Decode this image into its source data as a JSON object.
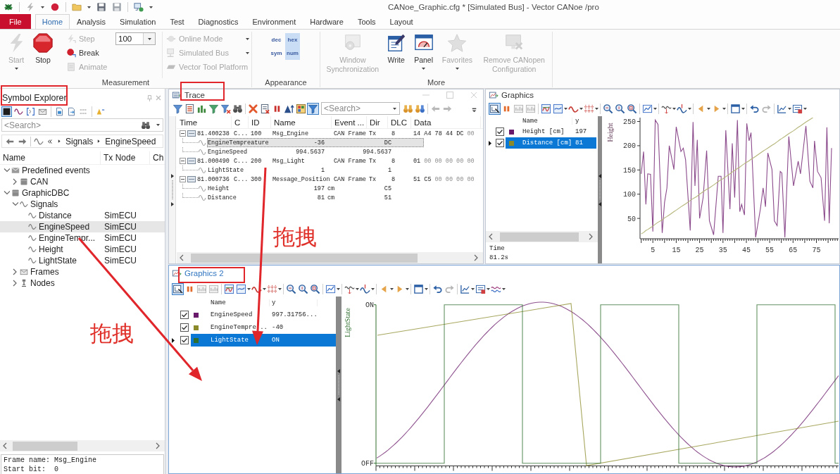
{
  "window": {
    "title": "CANoe_Graphic.cfg * [Simulated Bus] - Vector CANoe /pro"
  },
  "ribbon": {
    "tabs": [
      {
        "label": "File",
        "kind": "file",
        "selected": false
      },
      {
        "label": "Home",
        "kind": "tab",
        "selected": true
      },
      {
        "label": "Analysis",
        "kind": "tab",
        "selected": false
      },
      {
        "label": "Simulation",
        "kind": "tab",
        "selected": false
      },
      {
        "label": "Test",
        "kind": "tab",
        "selected": false
      },
      {
        "label": "Diagnostics",
        "kind": "tab",
        "selected": false
      },
      {
        "label": "Environment",
        "kind": "tab",
        "selected": false
      },
      {
        "label": "Hardware",
        "kind": "tab",
        "selected": false
      },
      {
        "label": "Tools",
        "kind": "tab",
        "selected": false
      },
      {
        "label": "Layout",
        "kind": "tab",
        "selected": false
      }
    ],
    "groups": [
      {
        "label": "Measurement",
        "items": [
          {
            "kind": "large",
            "label": "Start",
            "disabled": true,
            "menu": true
          },
          {
            "kind": "large",
            "label": "Stop",
            "disabled": false,
            "menu": false
          },
          {
            "kind": "small",
            "label": "Step",
            "disabled": true,
            "menu": false
          },
          {
            "kind": "small",
            "label": "Break",
            "disabled": false,
            "menu": false
          },
          {
            "kind": "small",
            "label": "Animate",
            "disabled": true,
            "menu": false
          },
          {
            "kind": "combo",
            "value": "100",
            "disabled": false,
            "menu": true
          },
          {
            "kind": "small",
            "label": "Online Mode",
            "disabled": true,
            "menu": true
          },
          {
            "kind": "small",
            "label": "Simulated Bus",
            "disabled": true,
            "menu": true
          },
          {
            "kind": "small",
            "label": "Vector Tool Platform",
            "disabled": true,
            "menu": false
          }
        ]
      },
      {
        "label": "Appearance",
        "items": [
          {
            "kind": "toggle",
            "label": "dec",
            "selected": false,
            "disabled": false,
            "menu": false
          },
          {
            "kind": "toggle",
            "label": "hex",
            "selected": true,
            "disabled": false,
            "menu": false
          },
          {
            "kind": "toggle",
            "label": "sym",
            "selected": false,
            "disabled": false,
            "menu": false
          },
          {
            "kind": "toggle",
            "label": "num",
            "selected": true,
            "disabled": false,
            "menu": false
          }
        ]
      },
      {
        "label": "More",
        "items": [
          {
            "kind": "large",
            "label": "Window Synchronization",
            "disabled": true,
            "menu": false
          },
          {
            "kind": "large",
            "label": "Write",
            "disabled": false,
            "menu": false
          },
          {
            "kind": "large",
            "label": "Panel",
            "disabled": false,
            "menu": true
          },
          {
            "kind": "large",
            "label": "Favorites",
            "disabled": true,
            "menu": true
          },
          {
            "kind": "large",
            "label": "Remove CANopen Configuration",
            "disabled": true,
            "menu": false
          }
        ]
      }
    ]
  },
  "symbol_explorer": {
    "title": "Symbol Explorer",
    "toolbar": [
      {
        "kind": "button",
        "on": true
      },
      {
        "kind": "button",
        "on": false
      },
      {
        "kind": "button",
        "on": false
      },
      {
        "kind": "button",
        "on": false
      },
      {
        "kind": "button",
        "on": false
      },
      {
        "kind": "button",
        "on": false
      },
      {
        "kind": "button",
        "on": false
      },
      {
        "kind": "button",
        "on": false
      }
    ],
    "search": {
      "placeholder": "<Search>"
    },
    "breadcrumb": [
      "Signals",
      "EngineSpeed"
    ],
    "columns": [
      "Name",
      "Tx Node",
      "Ch"
    ],
    "tree": [
      {
        "label": "Predefined events",
        "kind": "events",
        "expanded": true,
        "selected": false,
        "children": [
          {
            "label": "CAN",
            "kind": "bus",
            "expanded": false,
            "selected": false
          }
        ]
      },
      {
        "label": "GraphicDBC",
        "kind": "database",
        "expanded": true,
        "selected": false,
        "children": [
          {
            "label": "Signals",
            "kind": "signals",
            "expanded": true,
            "selected": false,
            "children": [
              {
                "label": "Distance",
                "kind": "signal",
                "tx_node": "SimECU",
                "selected": false
              },
              {
                "label": "EngineSpeed",
                "kind": "signal",
                "tx_node": "SimECU",
                "selected": true
              },
              {
                "label": "EngineTempr...",
                "kind": "signal",
                "tx_node": "SimECU",
                "selected": false
              },
              {
                "label": "Height",
                "kind": "signal",
                "tx_node": "SimECU",
                "selected": false
              },
              {
                "label": "LightState",
                "kind": "signal",
                "tx_node": "SimECU",
                "selected": false
              }
            ]
          },
          {
            "label": "Frames",
            "kind": "frames",
            "expanded": false,
            "selected": false
          },
          {
            "label": "Nodes",
            "kind": "nodes",
            "expanded": false,
            "selected": false
          }
        ]
      }
    ],
    "details": [
      {
        "label": "Frame name:",
        "value": "Msg_Engine"
      },
      {
        "label": "Start bit:",
        "value": "0"
      }
    ]
  },
  "trace": {
    "title": "Trace",
    "active": false,
    "toolbar": [
      {
        "kind": "button",
        "on": false
      },
      {
        "kind": "button",
        "on": false
      },
      {
        "kind": "button",
        "on": false
      },
      {
        "kind": "button",
        "on": false
      },
      {
        "kind": "button",
        "on": false
      },
      {
        "kind": "button",
        "on": false
      },
      {
        "kind": "button",
        "on": false
      },
      {
        "kind": "button",
        "on": false
      },
      {
        "kind": "button",
        "on": false
      },
      {
        "kind": "button",
        "on": false
      },
      {
        "kind": "button",
        "on": false
      },
      {
        "kind": "button",
        "on": true
      },
      {
        "kind": "button",
        "on": false
      },
      {
        "kind": "button",
        "on": false
      },
      {
        "kind": "button",
        "on": false
      },
      {
        "kind": "button",
        "on": false
      },
      {
        "kind": "button",
        "on": false
      }
    ],
    "search": {
      "placeholder": "<Search>"
    },
    "columns": [
      "Time",
      "C",
      "ID",
      "Name",
      "Event ...",
      "Dir",
      "DLC",
      "Data"
    ],
    "rows": [
      {
        "time": "81.400238",
        "channel": "C...",
        "id": "100",
        "name": "Msg_Engine",
        "event_type": "CAN Frame",
        "dir": "Tx",
        "dlc": "8",
        "data": "14 A4 78 44 DC",
        "data_dim": "00",
        "expanded": true,
        "selected": false,
        "children": [
          {
            "name": "EngineTempreature",
            "value": "-36",
            "raw": "DC",
            "selected": true
          },
          {
            "name": "EngineSpeed",
            "value": "994.5637",
            "raw": "994.5637",
            "selected": false
          }
        ]
      },
      {
        "time": "81.000490",
        "channel": "C...",
        "id": "200",
        "name": "Msg_Light",
        "event_type": "CAN Frame",
        "dir": "Tx",
        "dlc": "8",
        "data": "01",
        "data_dim": "00 00 00 00 00",
        "expanded": true,
        "selected": false,
        "children": [
          {
            "name": "LightState",
            "value": "1",
            "raw": "1",
            "selected": false
          }
        ]
      },
      {
        "time": "81.000736",
        "channel": "C...",
        "id": "300",
        "name": "Message_Position",
        "event_type": "CAN Frame",
        "dir": "Tx",
        "dlc": "8",
        "data": "51 C5",
        "data_dim": "00 00 00 00",
        "expanded": true,
        "selected": false,
        "children": [
          {
            "name": "Height",
            "value": "197",
            "unit": "cm",
            "raw": "C5",
            "selected": false
          },
          {
            "name": "Distance",
            "value": "81",
            "unit": "cm",
            "raw": "51",
            "selected": false
          }
        ]
      }
    ]
  },
  "graphics": {
    "title": "Graphics",
    "active": false,
    "toolbar": [
      {
        "kind": "button",
        "on": true
      },
      {
        "kind": "button",
        "on": false
      },
      {
        "kind": "button",
        "on": false
      },
      {
        "kind": "button",
        "on": false
      },
      {
        "kind": "button",
        "on": false
      },
      {
        "kind": "dropdown",
        "on": false
      },
      {
        "kind": "dropdown",
        "on": false
      },
      {
        "kind": "dropdown",
        "on": false
      },
      {
        "kind": "button",
        "on": false
      },
      {
        "kind": "button",
        "on": false
      },
      {
        "kind": "button",
        "on": false
      },
      {
        "kind": "dropdown",
        "on": false
      },
      {
        "kind": "dropdown",
        "on": false
      },
      {
        "kind": "dropdown",
        "on": false
      },
      {
        "kind": "dropdown",
        "on": false
      },
      {
        "kind": "dropdown",
        "on": false
      },
      {
        "kind": "dropdown",
        "on": false
      },
      {
        "kind": "button",
        "on": false
      },
      {
        "kind": "button",
        "on": false
      },
      {
        "kind": "dropdown",
        "on": false
      },
      {
        "kind": "dropdown",
        "on": false
      }
    ],
    "columns": [
      "Name",
      "y"
    ],
    "signals": [
      {
        "value": "197",
        "color": "#6a1a6a",
        "checked": true,
        "selected": false
      },
      {
        "value": "81",
        "color": "#8a8a2a",
        "checked": true,
        "selected": true
      }
    ],
    "cursor": {
      "label": "Time",
      "value": "81.2s"
    },
    "chart_data": {
      "type": "line",
      "ylabel": "Height",
      "x": [
        0,
        1,
        2,
        2.8,
        4,
        5,
        6,
        7.2,
        9,
        10,
        11,
        12,
        14,
        15,
        17,
        18,
        19,
        21,
        22.2,
        23,
        24,
        25,
        26.5,
        28,
        29.2,
        31,
        33,
        34.2,
        35,
        36.2,
        38,
        39,
        40,
        41.2,
        42.2,
        43,
        44.2,
        45.2,
        46.2,
        47,
        49,
        51,
        52.2,
        53.2,
        54.2,
        56,
        57,
        58.2,
        59.5,
        60.2,
        61.5,
        63.2,
        65.2,
        67.2,
        68.2,
        70.5,
        72.2,
        73.5,
        74.2,
        75.5,
        77,
        78.5,
        79.5,
        80.5,
        81.5
      ],
      "series": [
        {
          "name": "Height [cm]",
          "color": "#8b4a8b",
          "values": [
            142,
            188,
            79,
            142,
            141,
            23,
            253,
            244,
            20,
            83,
            113,
            200,
            151,
            239,
            188,
            195,
            171,
            25,
            249,
            117,
            212,
            50,
            93,
            190,
            45,
            16,
            137,
            137,
            20,
            232,
            69,
            205,
            93,
            253,
            64,
            79,
            57,
            246,
            210,
            227,
            11,
            69,
            113,
            74,
            185,
            151,
            45,
            35,
            147,
            144,
            11,
            219,
            117,
            168,
            142,
            241,
            127,
            113,
            210,
            147,
            134,
            45,
            238,
            40,
            195
          ]
        },
        {
          "name": "Distance [cm]",
          "color": "#b5b57a",
          "values": [
            18,
            21,
            25,
            27,
            31,
            34,
            38,
            42,
            47,
            51,
            54,
            57,
            64,
            67,
            74,
            77,
            80,
            87,
            91,
            93,
            96,
            100,
            105,
            110,
            113,
            119,
            126,
            130,
            132,
            136,
            142,
            146,
            149,
            153,
            156,
            159,
            163,
            166,
            169,
            172,
            178,
            185,
            189,
            192,
            195,
            201,
            204,
            208,
            213,
            215,
            219,
            225,
            231,
            238,
            241,
            249,
            254,
            258,
            null,
            null,
            null,
            null,
            null,
            null,
            null
          ]
        }
      ],
      "xlim": [
        -0.5,
        84.5
      ],
      "ylim": [
        8,
        258
      ],
      "xticks": [
        5,
        15,
        25,
        35,
        45,
        55,
        65,
        75
      ],
      "yticks": [
        50,
        100,
        150,
        200,
        250
      ]
    }
  },
  "graphics_2": {
    "title": "Graphics 2",
    "active": true,
    "toolbar": [
      {
        "kind": "button",
        "on": true
      },
      {
        "kind": "button",
        "on": false
      },
      {
        "kind": "button",
        "on": false
      },
      {
        "kind": "button",
        "on": false
      },
      {
        "kind": "button",
        "on": false
      },
      {
        "kind": "dropdown",
        "on": false
      },
      {
        "kind": "dropdown",
        "on": false
      },
      {
        "kind": "dropdown",
        "on": false
      },
      {
        "kind": "button",
        "on": false
      },
      {
        "kind": "button",
        "on": false
      },
      {
        "kind": "button",
        "on": false
      },
      {
        "kind": "dropdown",
        "on": false
      },
      {
        "kind": "dropdown",
        "on": false
      },
      {
        "kind": "dropdown",
        "on": false
      },
      {
        "kind": "dropdown",
        "on": false
      },
      {
        "kind": "dropdown",
        "on": false
      },
      {
        "kind": "dropdown",
        "on": false
      },
      {
        "kind": "button",
        "on": false
      },
      {
        "kind": "button",
        "on": false
      },
      {
        "kind": "dropdown",
        "on": false
      },
      {
        "kind": "dropdown",
        "on": false
      },
      {
        "kind": "dropdown",
        "on": false
      }
    ],
    "columns": [
      "Name",
      "y"
    ],
    "signals": [
      {
        "name": "EngineSpeed",
        "value": "997.31756...",
        "color": "#6a1a6a",
        "checked": true,
        "selected": false
      },
      {
        "name": "EngineTempre...",
        "value": "-40",
        "color": "#8a8a2a",
        "checked": true,
        "selected": false
      },
      {
        "name": "LightState",
        "value": "ON",
        "color": "#2e6e2e",
        "checked": true,
        "selected": true
      }
    ],
    "plot": {
      "axis_title": "LightState",
      "top_label": "ON",
      "bottom_label": "OFF"
    }
  },
  "annotations": {
    "labels": [
      "拖拽",
      "拖拽"
    ]
  }
}
